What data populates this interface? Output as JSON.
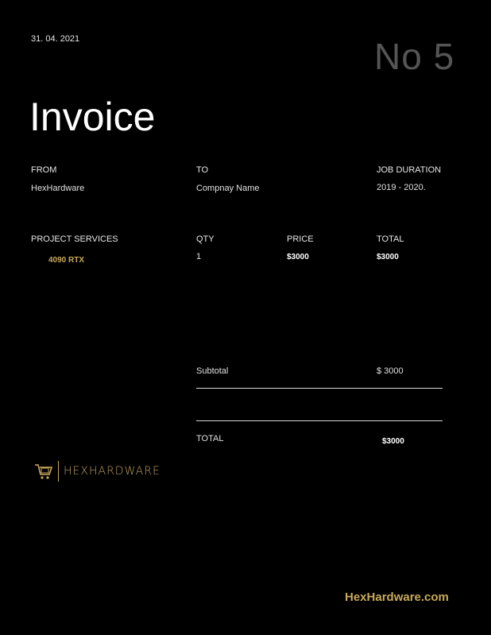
{
  "header": {
    "date": "31. 04. 2021",
    "invoice_number": "No 5",
    "title": "Invoice"
  },
  "parties": {
    "from_label": "FROM",
    "from_value": "HexHardware",
    "to_label": "TO",
    "to_value": "Compnay Name",
    "duration_label": "JOB DURATION",
    "duration_value": "2019 - 2020."
  },
  "items": {
    "headers": [
      "PROJECT SERVICES",
      "QTY",
      "PRICE",
      "TOTAL"
    ],
    "rows": [
      {
        "service": "4090 RTX",
        "qty": "1",
        "price": "$3000",
        "total": "$3000"
      }
    ]
  },
  "totals": {
    "subtotal_label": "Subtotal",
    "subtotal_value": "$ 3000",
    "total_label": "TOTAL",
    "total_value": "$3000"
  },
  "brand": {
    "logo_text": "HEXHARDWARE",
    "website": "HexHardware.com",
    "accent": "#c9a95a"
  }
}
